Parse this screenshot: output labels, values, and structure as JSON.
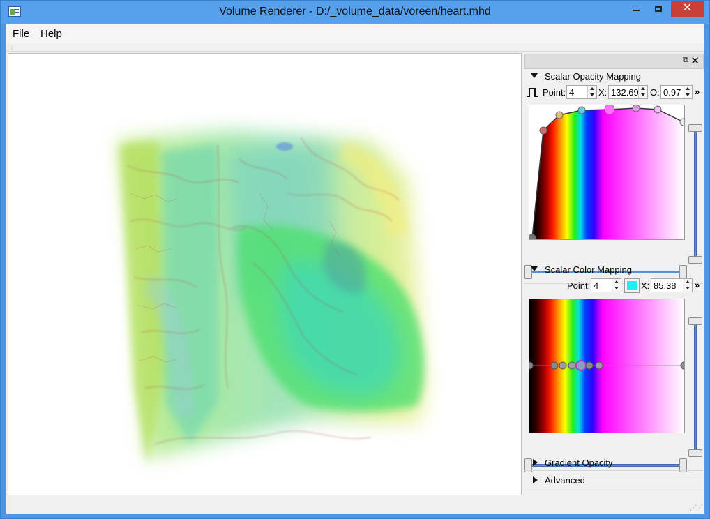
{
  "window": {
    "title": "Volume Renderer - D:/_volume_data/voreen/heart.mhd",
    "minimize_glyph": "",
    "maximize_glyph": "",
    "close_glyph": "✕"
  },
  "menu": {
    "file": "File",
    "help": "Help"
  },
  "dock": {
    "float_glyph": "⧉",
    "close_glyph": "✕"
  },
  "opacity": {
    "header": "Scalar Opacity Mapping",
    "point_label": "Point:",
    "point_value": "4",
    "x_label": "X:",
    "x_value": "132.69",
    "o_label": "O:",
    "o_value": "0.97",
    "more": "»",
    "step_icon": "step-function-icon"
  },
  "color": {
    "header": "Scalar Color Mapping",
    "point_label": "Point:",
    "point_value": "4",
    "x_label": "X:",
    "x_value": "85.38",
    "more": "»",
    "swatch_color": "#1ef0f0"
  },
  "gradient": {
    "header": "Gradient Opacity"
  },
  "advanced": {
    "header": "Advanced"
  },
  "colors": {
    "accent": "#4d96e3",
    "close": "#c84037",
    "slider": "#5a8fd0"
  }
}
